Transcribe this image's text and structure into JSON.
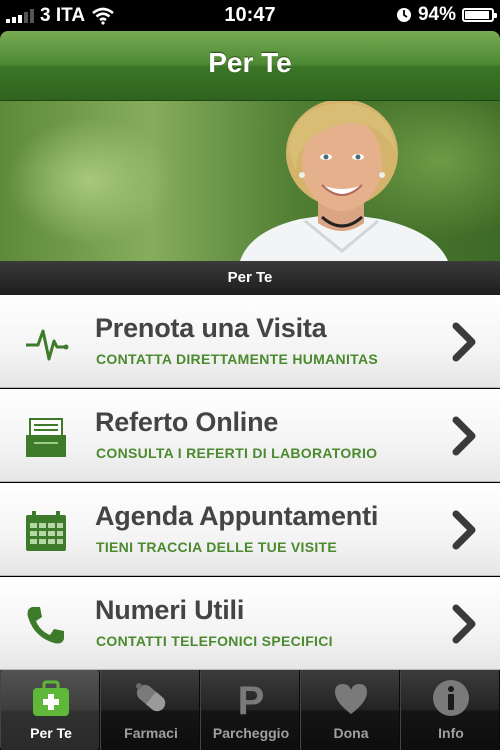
{
  "status_bar": {
    "carrier": "3 ITA",
    "time": "10:47",
    "battery": "94%",
    "battery_level": 0.94
  },
  "nav": {
    "title": "Per Te"
  },
  "hero": {
    "caption": "Per Te"
  },
  "menu": {
    "items": [
      {
        "title": "Prenota una Visita",
        "subtitle": "CONTATTA DIRETTAMENTE HUMANITAS",
        "icon": "heartbeat-icon"
      },
      {
        "title": "Referto Online",
        "subtitle": "CONSULTA I REFERTI DI LABORATORIO",
        "icon": "inbox-tray-icon"
      },
      {
        "title": "Agenda Appuntamenti",
        "subtitle": "TIENI TRACCIA DELLE TUE VISITE",
        "icon": "calendar-icon"
      },
      {
        "title": "Numeri Utili",
        "subtitle": "CONTATTI TELEFONICI SPECIFICI",
        "icon": "phone-icon"
      }
    ]
  },
  "tabs": [
    {
      "label": "Per Te",
      "icon": "medical-kit-icon",
      "active": true
    },
    {
      "label": "Farmaci",
      "icon": "pill-icon",
      "active": false
    },
    {
      "label": "Parcheggio",
      "icon": "parking-icon",
      "active": false
    },
    {
      "label": "Dona",
      "icon": "heart-icon",
      "active": false
    },
    {
      "label": "Info",
      "icon": "info-icon",
      "active": false
    }
  ],
  "colors": {
    "accent_green": "#4b8a2e",
    "nav_green": "#3b7526",
    "title_gray": "#444444"
  }
}
